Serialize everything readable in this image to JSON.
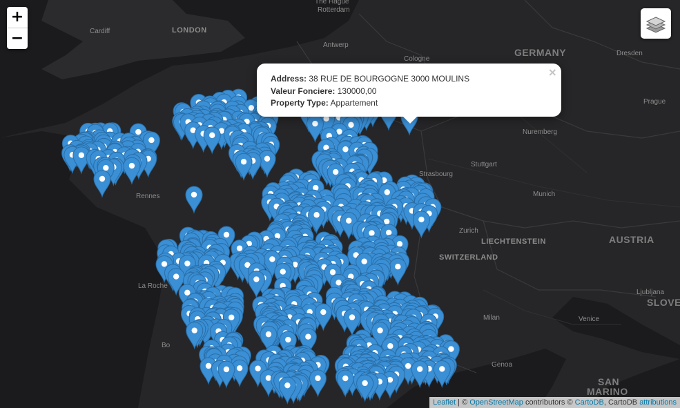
{
  "map": {
    "zoom_in": "+",
    "zoom_out": "−",
    "layers_icon": "layers-icon",
    "marker_color": "#3a8fd5",
    "marker_stroke": "#2a6ea7"
  },
  "labels": {
    "the_hague": "The Hague",
    "rotterdam": "Rotterdam",
    "london": "LONDON",
    "cardiff": "Cardiff",
    "antwerp": "Antwerp",
    "cologne": "Cologne",
    "germany": "GERMANY",
    "dresden": "Dresden",
    "prague": "Prague",
    "nuremberg": "Nuremberg",
    "stuttgart": "Stuttgart",
    "strasbourg": "Strasbourg",
    "munich": "Munich",
    "zurich": "Zurich",
    "liechtenstein": "LIECHTENSTEIN",
    "austria": "AUSTRIA",
    "switzerland": "SWITZERLAND",
    "rennes": "Rennes",
    "la_rochelle": "La Roche",
    "bordeaux": "Bo",
    "milan": "Milan",
    "venice": "Venice",
    "ljubljana": "Ljubljana",
    "slovenia": "SLOVE",
    "genoa": "Genoa",
    "san_marino": "SAN",
    "marino": "MARINO"
  },
  "popup": {
    "address_label": "Address:",
    "address_value": "38 RUE DE BOURGOGNE 3000 MOULINS",
    "valeur_label": "Valeur Fonciere:",
    "valeur_value": "130000,00",
    "type_label": "Property Type:",
    "type_value": "Appartement",
    "close": "×"
  },
  "attribution": {
    "leaflet": "Leaflet",
    "sep": " | © ",
    "osm": "OpenStreetMap",
    "contributors": " contributors © ",
    "cartodb": "CartoDB",
    "cartodb_sep": ", CartoDB ",
    "attributions": "attributions"
  }
}
